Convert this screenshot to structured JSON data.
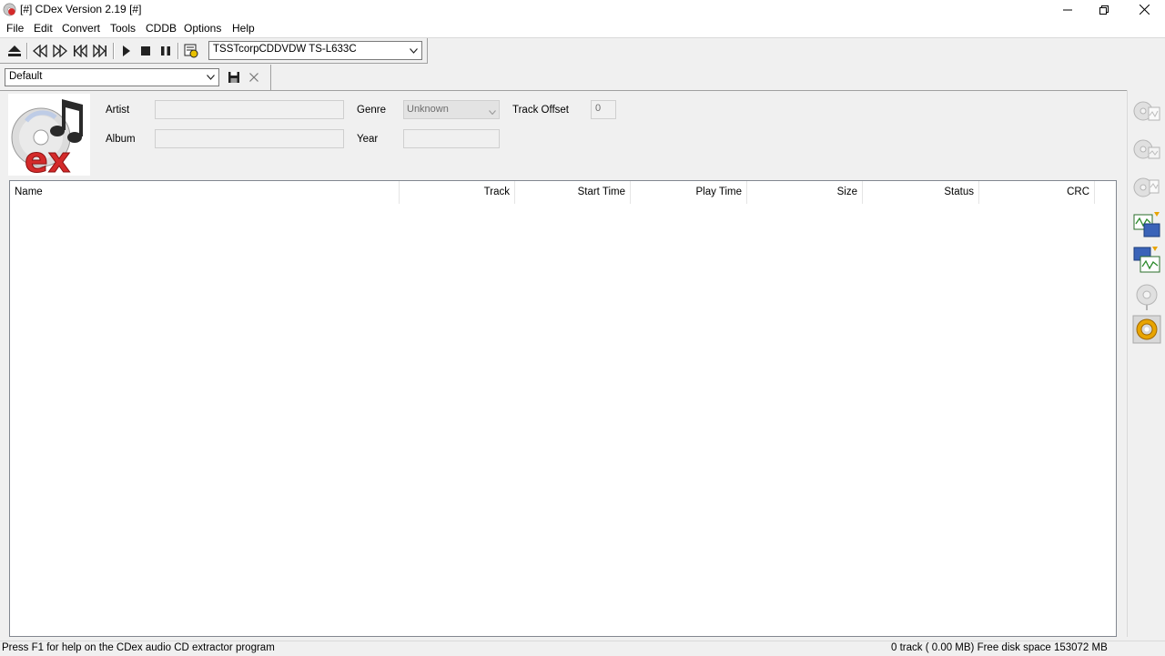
{
  "window": {
    "title": "[#] CDex Version 2.19 [#]"
  },
  "menu": [
    "File",
    "Edit",
    "Convert",
    "Tools",
    "CDDB",
    "Options",
    "Help"
  ],
  "toolbar": {
    "buttons": [
      "eject-icon",
      "rewind-icon",
      "fast-forward-icon",
      "previous-track-icon",
      "next-track-icon",
      "play-icon",
      "stop-icon",
      "pause-icon",
      "cd-info-icon"
    ],
    "drive": "TSSTcorpCDDVDW TS-L633C"
  },
  "profile": {
    "value": "Default"
  },
  "info": {
    "artist_label": "Artist",
    "artist_value": "",
    "album_label": "Album",
    "album_value": "",
    "genre_label": "Genre",
    "genre_value": "Unknown",
    "year_label": "Year",
    "year_value": "",
    "offset_label": "Track Offset",
    "offset_value": "0"
  },
  "tracklist": {
    "columns": [
      "Name",
      "Track",
      "Start Time",
      "Play Time",
      "Size",
      "Status",
      "CRC"
    ],
    "rows": []
  },
  "right_toolbar": [
    "extract-wav-icon",
    "extract-compressed-icon",
    "extract-partial-icon",
    "convert-to-compressed-icon",
    "convert-to-wav-icon",
    "record-icon",
    "configure-icon"
  ],
  "status": {
    "help": "Press F1 for help on the CDex audio CD extractor program",
    "summary": "0 track ( 0.00 MB) Free disk space 153072 MB"
  },
  "colors": {
    "background": "#f0f0f0",
    "accent_red": "#d42a2a"
  }
}
